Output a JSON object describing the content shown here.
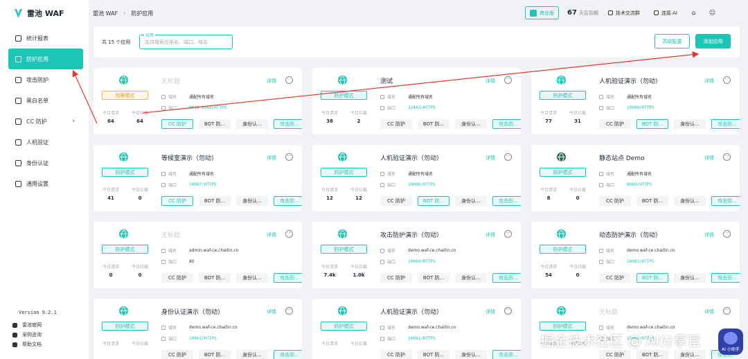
{
  "brand": {
    "name": "雷池 WAF"
  },
  "sidebar": {
    "items": [
      {
        "label": "统计报表",
        "icon": "chart-icon"
      },
      {
        "label": "防护应用",
        "icon": "shield-icon",
        "active": true
      },
      {
        "label": "攻击防护",
        "icon": "attack-icon"
      },
      {
        "label": "黑白名单",
        "icon": "list-icon"
      },
      {
        "label": "CC 防护",
        "icon": "cc-icon",
        "chevron": "›"
      },
      {
        "label": "人机验证",
        "icon": "human-icon"
      },
      {
        "label": "身份认证",
        "icon": "key-icon"
      },
      {
        "label": "通用设置",
        "icon": "gear-icon"
      }
    ],
    "version": "Version 9.2.1",
    "links": [
      {
        "label": "雷池官网"
      },
      {
        "label": "采购咨询"
      },
      {
        "label": "帮助文档"
      }
    ]
  },
  "header": {
    "breadcrumb": [
      "雷池 WAF",
      "防护应用"
    ],
    "edition": "商业版",
    "days_value": "67",
    "days_label": "天后到期",
    "community": "技术交流群",
    "ai": "连接 AI",
    "accent": "#1dc5b6"
  },
  "filter": {
    "count": "共 15 个应用",
    "search_label": "应用",
    "search_placeholder": "支持搜索应用名、端口、域名",
    "advanced": "高级配置",
    "add": "添加应用"
  },
  "card_labels": {
    "detail": "详情",
    "domain": "域名",
    "port": "端口",
    "today_req": "今日请求",
    "today_block": "今日拦截"
  },
  "cards": [
    {
      "name": "无标题",
      "muted": true,
      "mode": "观察模式",
      "mode_type": "observe",
      "domain": "通配所有域名",
      "port": "8010 8443/HTTPS",
      "req": "64",
      "block": "64",
      "tags": [
        "CC 防护",
        "BOT 防...",
        "身份认...",
        "攻击防..."
      ],
      "on": [
        true,
        false,
        false,
        true
      ]
    },
    {
      "name": "测试",
      "mode": "防护模式",
      "domain": "通配所有域名",
      "port": "22443/HTTPS",
      "req": "38",
      "block": "2",
      "tags": [
        "CC 防护",
        "BOT 防...",
        "身份认...",
        "攻击防..."
      ],
      "on": [
        false,
        false,
        false,
        true
      ]
    },
    {
      "name": "人机验证演示（勿动）",
      "mode": "防护模式",
      "domain": "通配所有域名",
      "port": "10080/HTTPS",
      "req": "77",
      "block": "31",
      "tags": [
        "CC 防护",
        "BOT 防...",
        "身份认...",
        "攻击防..."
      ],
      "on": [
        false,
        true,
        false,
        true
      ]
    },
    {
      "name": "等候室演示（勿动）",
      "mode": "防护模式",
      "domain": "通配所有域名",
      "port": "10087/HTTPS",
      "req": "41",
      "block": "0",
      "tags": [
        "CC 防护",
        "BOT 防...",
        "身份认...",
        "攻击防..."
      ],
      "on": [
        true,
        false,
        false,
        true
      ]
    },
    {
      "name": "人机验证演示（勿动）",
      "mode": "防护模式",
      "domain": "通配所有域名",
      "port": "10086/HTTPS",
      "req": "12",
      "block": "12",
      "tags": [
        "CC 防护",
        "BOT 防...",
        "身份认...",
        "攻击防..."
      ],
      "on": [
        false,
        true,
        false,
        true
      ]
    },
    {
      "name": "静态站点 Demo",
      "mode": "防护模式",
      "domain": "通配所有域名",
      "port": "8989/HTTPS",
      "req": "8",
      "block": "0",
      "tags": [
        "CC 防护",
        "BOT 防...",
        "身份认...",
        "攻击防..."
      ],
      "on": [
        false,
        false,
        false,
        true
      ],
      "demo": true
    },
    {
      "name": "无标题",
      "muted": true,
      "mode": "防护模式",
      "domain": "admin.waf-ce.chaitin.cn",
      "port": "80",
      "port_plain": true,
      "req": "0",
      "block": "0",
      "tags": [
        "CC 防护",
        "BOT 防...",
        "身份认...",
        "攻击防..."
      ],
      "on": [
        false,
        false,
        false,
        true
      ]
    },
    {
      "name": "攻击防护演示（勿动）",
      "mode": "防护模式",
      "domain": "demo.waf-ce.chaitin.cn",
      "port": "10084/HTTPS",
      "req": "7.4k",
      "block": "1.0k",
      "tags": [
        "CC 防护",
        "BOT 防...",
        "身份认...",
        "攻击防..."
      ],
      "on": [
        false,
        false,
        false,
        true
      ]
    },
    {
      "name": "动态防护演示（勿动）",
      "mode": "防护模式",
      "domain": "demo.waf-ce.chaitin.cn",
      "port": "10083/HTTPS",
      "req": "54",
      "block": "0",
      "tags": [
        "CC 防护",
        "BOT 防...",
        "身份认...",
        "攻击防..."
      ],
      "on": [
        false,
        true,
        false,
        true
      ]
    },
    {
      "name": "身份认证演示（勿动）",
      "mode": "防护模式",
      "domain": "demo.waf-ce.chaitin.cn",
      "port": "10082/HTTPS",
      "req": "",
      "block": "",
      "tags": [
        "CC 防护",
        "BOT 防...",
        "身份认...",
        "攻击防..."
      ],
      "on": [
        false,
        false,
        false,
        true
      ]
    },
    {
      "name": "人机验证演示（勿动）",
      "mode": "防护模式",
      "domain": "demo.waf-ce.chaitin.cn",
      "port": "10081/HTTPS",
      "req": "",
      "block": "",
      "tags": [
        "CC 防护",
        "BOT 防...",
        "身份认...",
        "攻击防..."
      ],
      "on": [
        false,
        false,
        false,
        true
      ]
    },
    {
      "name": "无标题",
      "muted": true,
      "mode": "防护模式",
      "domain": "demo.waf-ce.chaitin.cn",
      "port": "10080/HTTPS",
      "req": "",
      "block": "",
      "tags": [
        "CC 防护",
        "BOT 防...",
        "身份认...",
        "攻击防..."
      ],
      "on": [
        false,
        false,
        false,
        true
      ]
    }
  ],
  "watermark": "掘金技术社区 @ AI分享官",
  "ai_badge": "AI 小助手",
  "annotation_color": "#e5382e"
}
